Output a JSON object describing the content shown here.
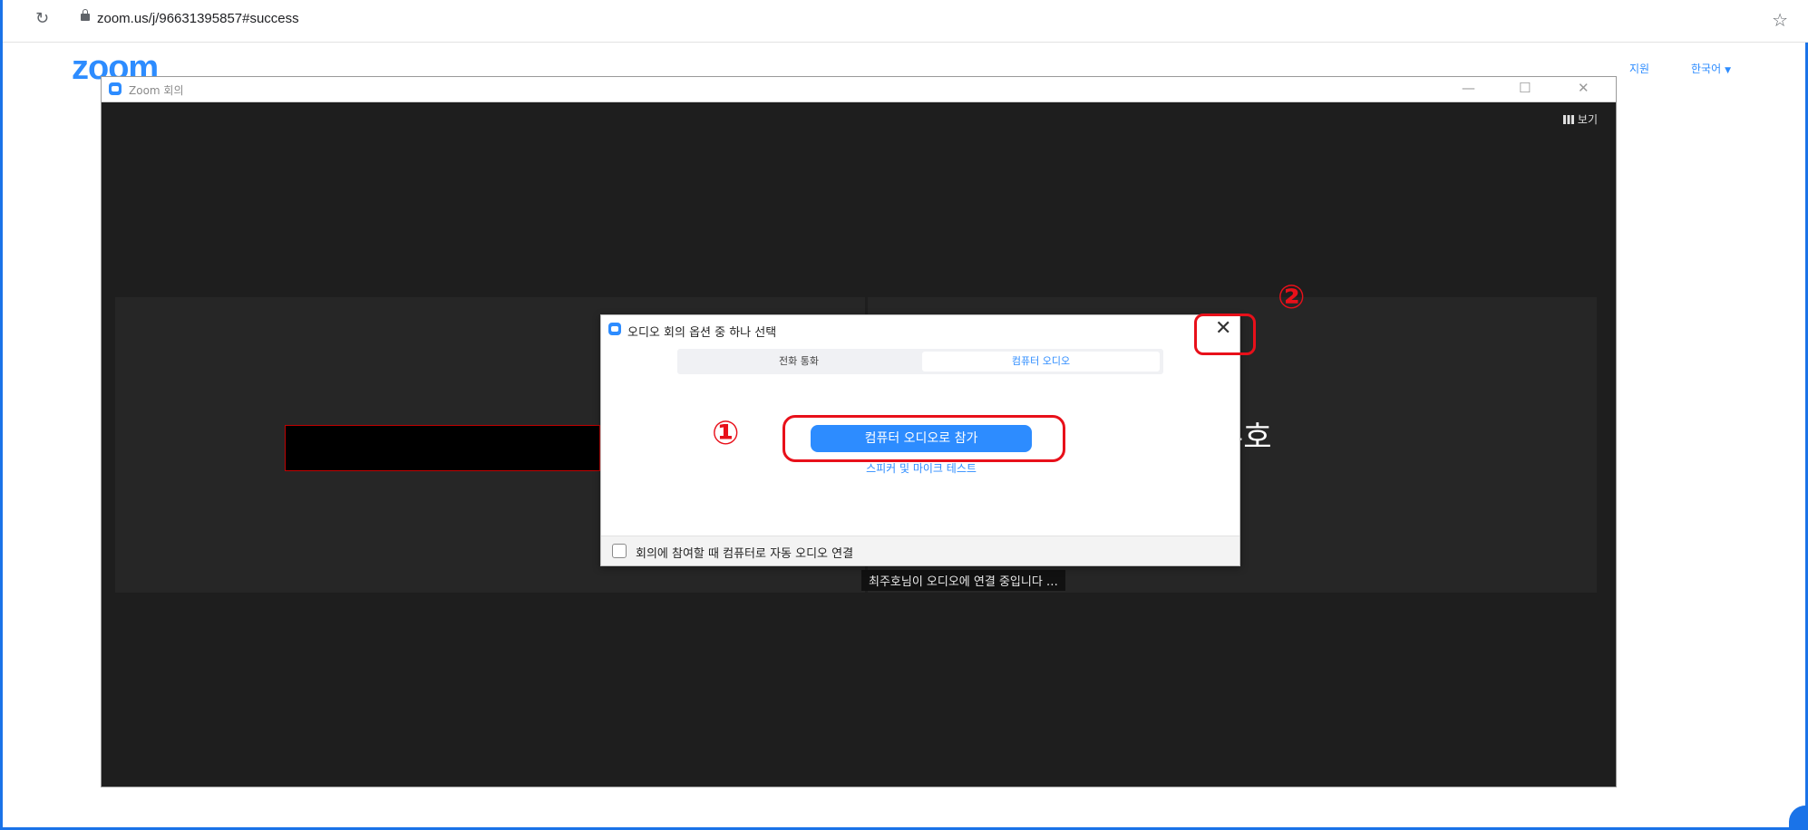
{
  "browser": {
    "reload_icon": "↻",
    "url": "zoom.us/j/96631395857#success",
    "bookmark_icon": "☆"
  },
  "site": {
    "logo": "zoom",
    "support": "지원",
    "language": "한국어",
    "language_caret": "▼"
  },
  "meeting_window": {
    "title": "Zoom 회의",
    "minimize": "—",
    "maximize": "☐",
    "close": "✕",
    "view_label": "보기",
    "participant_name_partial": "주호",
    "status": "최주호님이 오디오에 연결 중입니다 …"
  },
  "audio_dialog": {
    "title": "오디오 회의 옵션 중 하나 선택",
    "close": "✕",
    "tabs": [
      "전화 통화",
      "컴퓨터 오디오"
    ],
    "join_button": "컴퓨터 오디오로 참가",
    "test_link": "스피커 및 마이크 테스트",
    "auto_connect_label": "회의에 참여할 때 컴퓨터로 자동 오디오 연결"
  },
  "annotations": {
    "step1": "①",
    "step2": "②",
    "color": "#e8101a"
  },
  "colors": {
    "brand": "#2d8cff",
    "meeting_bg": "#1e1e1e"
  }
}
